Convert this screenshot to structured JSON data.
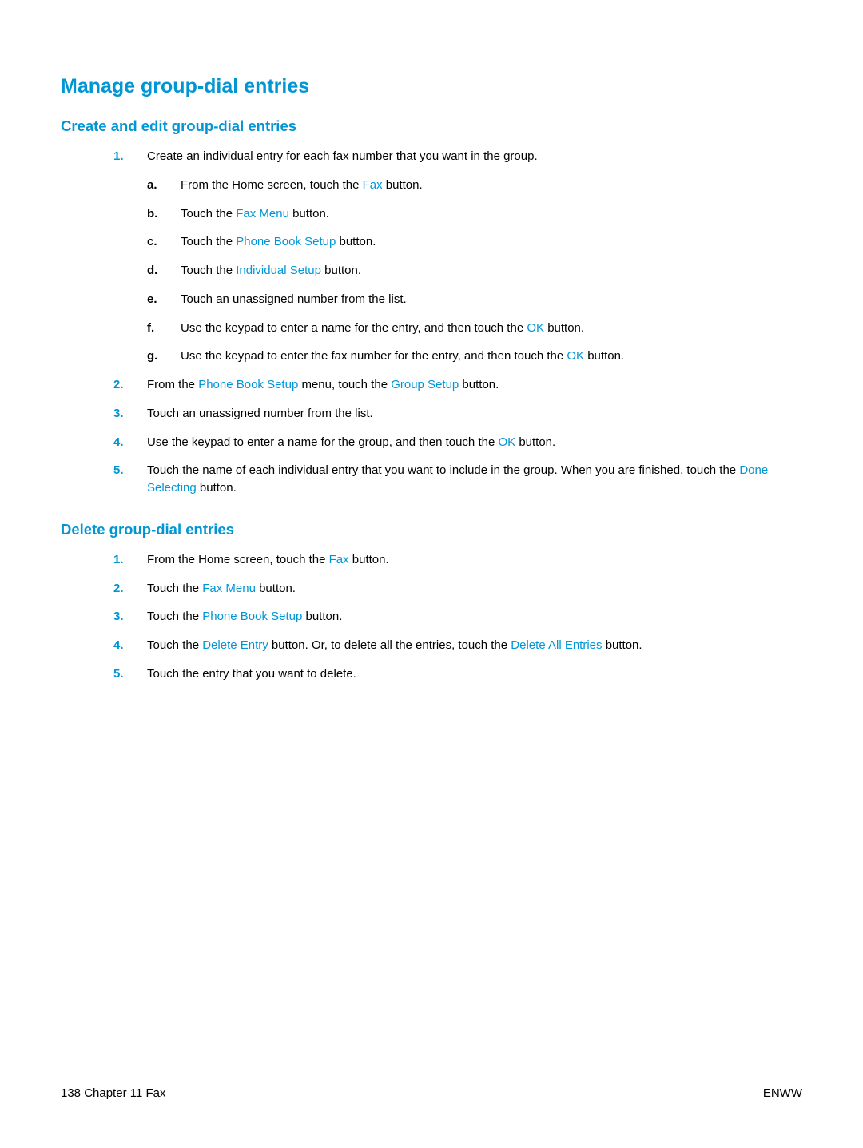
{
  "title": "Manage group-dial entries",
  "sections": {
    "create": {
      "heading": "Create and edit group-dial entries",
      "steps": {
        "1": {
          "marker": "1.",
          "text": "Create an individual entry for each fax number that you want in the group.",
          "sub": {
            "a": {
              "m": "a.",
              "p1": "From the Home screen, touch the ",
              "t1": "Fax",
              "p2": " button."
            },
            "b": {
              "m": "b.",
              "p1": "Touch the ",
              "t1": "Fax Menu",
              "p2": " button."
            },
            "c": {
              "m": "c.",
              "p1": "Touch the ",
              "t1": "Phone Book Setup",
              "p2": " button."
            },
            "d": {
              "m": "d.",
              "p1": "Touch the ",
              "t1": "Individual Setup",
              "p2": " button."
            },
            "e": {
              "m": "e.",
              "text": "Touch an unassigned number from the list."
            },
            "f": {
              "m": "f.",
              "p1": "Use the keypad to enter a name for the entry, and then touch the ",
              "t1": "OK",
              "p2": " button."
            },
            "g": {
              "m": "g.",
              "p1": "Use the keypad to enter the fax number for the entry, and then touch the ",
              "t1": "OK",
              "p2": " button."
            }
          }
        },
        "2": {
          "marker": "2.",
          "p1": "From the ",
          "t1": "Phone Book Setup",
          "p2": " menu, touch the ",
          "t2": "Group Setup",
          "p3": " button."
        },
        "3": {
          "marker": "3.",
          "text": "Touch an unassigned number from the list."
        },
        "4": {
          "marker": "4.",
          "p1": "Use the keypad to enter a name for the group, and then touch the ",
          "t1": "OK",
          "p2": " button."
        },
        "5": {
          "marker": "5.",
          "p1": "Touch the name of each individual entry that you want to include in the group. When you are finished, touch the ",
          "t1": "Done Selecting",
          "p2": " button."
        }
      }
    },
    "delete": {
      "heading": "Delete group-dial entries",
      "steps": {
        "1": {
          "marker": "1.",
          "p1": "From the Home screen, touch the ",
          "t1": "Fax",
          "p2": " button."
        },
        "2": {
          "marker": "2.",
          "p1": "Touch the ",
          "t1": "Fax Menu",
          "p2": " button."
        },
        "3": {
          "marker": "3.",
          "p1": "Touch the ",
          "t1": "Phone Book Setup",
          "p2": " button."
        },
        "4": {
          "marker": "4.",
          "p1": "Touch the ",
          "t1": "Delete Entry",
          "p2": " button. Or, to delete all the entries, touch the ",
          "t2": "Delete All Entries",
          "p3": " button."
        },
        "5": {
          "marker": "5.",
          "text": "Touch the entry that you want to delete."
        }
      }
    }
  },
  "footer": {
    "left": "138   Chapter 11   Fax",
    "right": "ENWW"
  }
}
